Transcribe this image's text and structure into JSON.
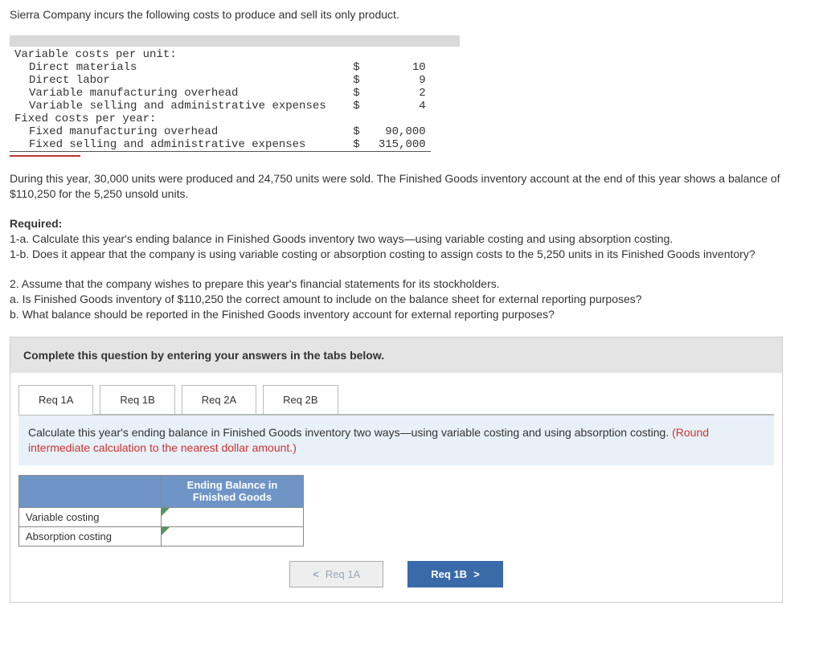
{
  "intro": "Sierra Company incurs the following costs to produce and sell its only product.",
  "variable_header": "Variable costs per unit:",
  "rows": {
    "dm": {
      "label": "Direct materials",
      "sym": "$",
      "val": "10"
    },
    "dl": {
      "label": "Direct labor",
      "sym": "$",
      "val": "9"
    },
    "vmoh": {
      "label": "Variable manufacturing overhead",
      "sym": "$",
      "val": "2"
    },
    "vsae": {
      "label": "Variable selling and administrative expenses",
      "sym": "$",
      "val": "4"
    }
  },
  "fixed_header": "Fixed costs per year:",
  "fixed": {
    "fmoh": {
      "label": "Fixed manufacturing overhead",
      "sym": "$",
      "val": "90,000"
    },
    "fsae": {
      "label": "Fixed selling and administrative expenses",
      "sym": "$",
      "val": "315,000"
    }
  },
  "body_para": "During this year, 30,000 units were produced and 24,750 units were sold. The Finished Goods inventory account at the end of this year shows a balance of $110,250 for the 5,250 unsold units.",
  "required": {
    "title": "Required:",
    "r1a": "1-a. Calculate this year's ending balance in Finished Goods inventory two ways—using variable costing and using absorption costing.",
    "r1b": "1-b. Does it appear that the company is using variable costing or absorption costing to assign costs to the 5,250 units in its Finished Goods inventory?",
    "r2": "2. Assume that the company wishes to prepare this year's financial statements for its stockholders.",
    "r2a": "a. Is Finished Goods inventory of $110,250 the correct amount to include on the balance sheet for external reporting purposes?",
    "r2b": "b. What balance should be reported in the Finished Goods inventory account for external reporting purposes?"
  },
  "instruction": "Complete this question by entering your answers in the tabs below.",
  "tabs": {
    "t1a": "Req 1A",
    "t1b": "Req 1B",
    "t2a": "Req 2A",
    "t2b": "Req 2B"
  },
  "prompt": {
    "main": "Calculate this year's ending balance in Finished Goods inventory two ways—using variable costing and using absorption costing. ",
    "red": "(Round intermediate calculation to the nearest dollar amount.)"
  },
  "table": {
    "header": "Ending Balance in Finished Goods",
    "row1": "Variable costing",
    "row2": "Absorption costing"
  },
  "nav": {
    "prev": "Req 1A",
    "next": "Req 1B"
  },
  "glyphs": {
    "left": "<",
    "right": ">"
  }
}
